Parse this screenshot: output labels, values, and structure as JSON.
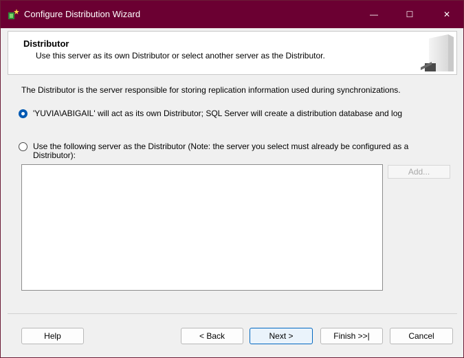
{
  "window": {
    "title": "Configure Distribution Wizard",
    "title_bar_color": "#6b0032",
    "controls": {
      "minimize_glyph": "—",
      "maximize_glyph": "☐",
      "close_glyph": "✕"
    }
  },
  "header": {
    "title": "Distributor",
    "subtitle": "Use this server as its own Distributor or select another server as the Distributor."
  },
  "main": {
    "description": "The Distributor is the server responsible for storing replication information used during synchronizations.",
    "options": [
      {
        "label": "'YUVIA\\ABIGAIL' will act as its own Distributor; SQL Server will create a distribution database and log",
        "selected": true
      },
      {
        "label": "Use the following server as the Distributor (Note: the server you select must already be configured as a Distributor):",
        "selected": false
      }
    ],
    "server_list": [],
    "add_button_label": "Add..."
  },
  "footer": {
    "help_label": "Help",
    "back_label": "< Back",
    "next_label": "Next >",
    "finish_label": "Finish >>|",
    "cancel_label": "Cancel"
  },
  "colors": {
    "accent": "#0059b3",
    "primary_button_border": "#0067c0"
  },
  "icons": {
    "app_icon": "wizard-star-icon",
    "header_graphic": "server-tower-icon"
  }
}
